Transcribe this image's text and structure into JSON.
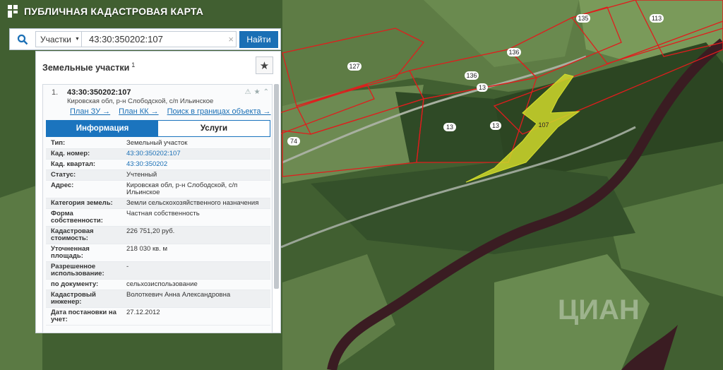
{
  "app": {
    "title": "ПУБЛИЧНАЯ КАДАСТРОВАЯ КАРТА",
    "logo_icon": "pkk-logo-icon"
  },
  "search": {
    "type_label": "Участки",
    "query": "43:30:350202:107",
    "submit_label": "Найти",
    "clear_icon": "×"
  },
  "panel": {
    "title": "Земельные участки",
    "count": "1",
    "fav_icon": "★"
  },
  "item": {
    "num": "1.",
    "cad_number": "43:30:350202:107",
    "address_short": "Кировская обл, р-н Слободской, с/п Ильинское",
    "links": [
      "План ЗУ →",
      "План КК →",
      "Поиск в границах объекта →"
    ]
  },
  "tabs": [
    "Информация",
    "Услуги"
  ],
  "properties": [
    {
      "key": "Тип:",
      "value": "Земельный участок"
    },
    {
      "key": "Кад. номер:",
      "value": "43:30:350202:107",
      "link": true
    },
    {
      "key": "Кад. квартал:",
      "value": "43:30:350202",
      "link": true
    },
    {
      "key": "Статус:",
      "value": "Учтенный"
    },
    {
      "key": "Адрес:",
      "value": "Кировская обл, р-н Слободской, с/п Ильинское"
    },
    {
      "key": "Категория земель:",
      "value": "Земли сельскохозяйственного назначения"
    },
    {
      "key": "Форма собственности:",
      "value": "Частная собственность"
    },
    {
      "key": "Кадастровая стоимость:",
      "value": "226 751,20 руб."
    },
    {
      "key": "Уточненная площадь:",
      "value": "218 030 кв. м"
    },
    {
      "key": "Разрешенное использование:",
      "value": "-"
    },
    {
      "key": "по документу:",
      "value": "сельхозиспользование"
    },
    {
      "key": "Кадастровый инженер:",
      "value": "Волоткевич Анна Александровна"
    },
    {
      "key": "Дата постановки на учет:",
      "value": "27.12.2012"
    }
  ],
  "map": {
    "plot_labels": [
      "127",
      "135",
      "113",
      "136",
      "136",
      "13",
      "107",
      "74",
      "13",
      "13"
    ],
    "highlight_color": "#cfd82a",
    "boundary_color": "#e01d1d",
    "watermark": "ЦИАН"
  }
}
